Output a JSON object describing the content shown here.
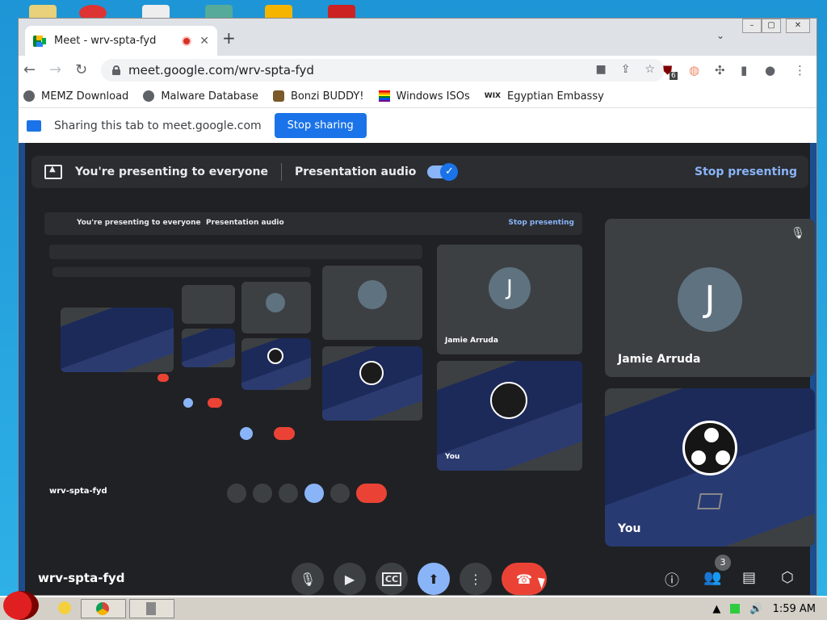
{
  "window": {
    "tab_title": "Meet - wrv-spta-fyd",
    "url": "meet.google.com/wrv-spta-fyd",
    "extension_badge": "6"
  },
  "bookmarks": [
    {
      "label": "MEMZ Download"
    },
    {
      "label": "Malware Database"
    },
    {
      "label": "Bonzi BUDDY!"
    },
    {
      "label": "Windows ISOs"
    },
    {
      "label": "Egyptian Embassy"
    }
  ],
  "share_bar": {
    "text": "Sharing this tab to meet.google.com",
    "stop_label": "Stop sharing"
  },
  "meet": {
    "presenting_text": "You're presenting to everyone",
    "audio_label": "Presentation audio",
    "stop_presenting": "Stop presenting",
    "meeting_code": "wrv-spta-fyd",
    "participants_count": "3",
    "tiles": [
      {
        "name": "Jamie Arruda",
        "initial": "J"
      },
      {
        "name": "You"
      }
    ]
  },
  "colors": {
    "accent": "#1a73e8",
    "hangup": "#ea4335",
    "meet_bg": "#202124"
  },
  "taskbar": {
    "clock": "1:59 AM"
  }
}
